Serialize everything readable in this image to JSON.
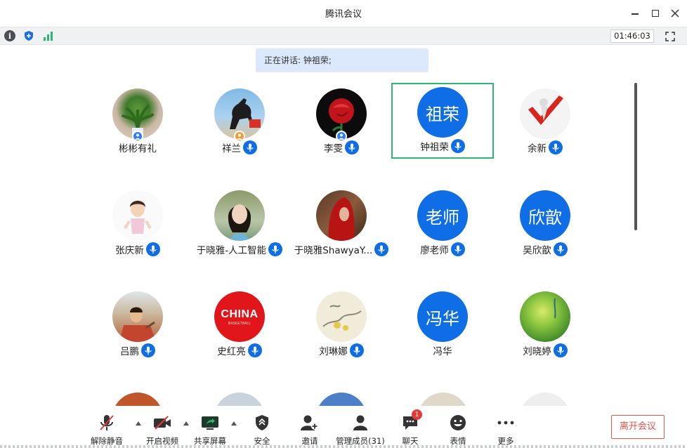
{
  "app": {
    "title": "腾讯会议"
  },
  "status": {
    "timer": "01:46:03"
  },
  "speaking": {
    "text": "正在讲话: 钟祖荣;"
  },
  "participants": [
    {
      "name": "彬彬有礼",
      "avatar": "plant-photo",
      "badge": "host"
    },
    {
      "name": "祥兰",
      "avatar": "horse-photo",
      "badge": "cohost-orange"
    },
    {
      "name": "李雯",
      "avatar": "rose-photo",
      "badge": "host"
    },
    {
      "name": "钟祖荣",
      "avatar_text": "祖荣",
      "active": true
    },
    {
      "name": "余新",
      "avatar": "red-check-photo"
    },
    {
      "name": "张庆新",
      "avatar": "cartoon-girl-photo"
    },
    {
      "name": "于晓雅-人工智能",
      "avatar": "woman-portrait-photo"
    },
    {
      "name": "于晓雅ShawyaY...",
      "avatar": "red-scarf-photo"
    },
    {
      "name": "廖老师",
      "avatar_text": "老师"
    },
    {
      "name": "吴欣歆",
      "avatar_text": "欣歆"
    },
    {
      "name": "吕鹏",
      "avatar": "painting-photo"
    },
    {
      "name": "史红亮",
      "avatar": "china-basketball-photo",
      "avatar_caption": "CHINA",
      "avatar_subcaption": "BASKETBALL"
    },
    {
      "name": "刘琳娜",
      "avatar": "flower-painting-photo"
    },
    {
      "name": "冯华",
      "avatar_text": "冯华"
    },
    {
      "name": "刘晓婷",
      "avatar": "green-planet-photo"
    }
  ],
  "toolbar": {
    "unmute": "解除静音",
    "video": "开启视频",
    "share": "共享屏幕",
    "security": "安全",
    "invite": "邀请",
    "members": "管理成员(31)",
    "chat": "聊天",
    "chat_badge": "1",
    "reactions": "表情",
    "more": "更多",
    "leave": "离开会议"
  },
  "colors": {
    "accent": "#0f6ee6",
    "active_border": "#2bb673",
    "leave": "#e5534b",
    "speaking_bg": "#dce8fb"
  }
}
